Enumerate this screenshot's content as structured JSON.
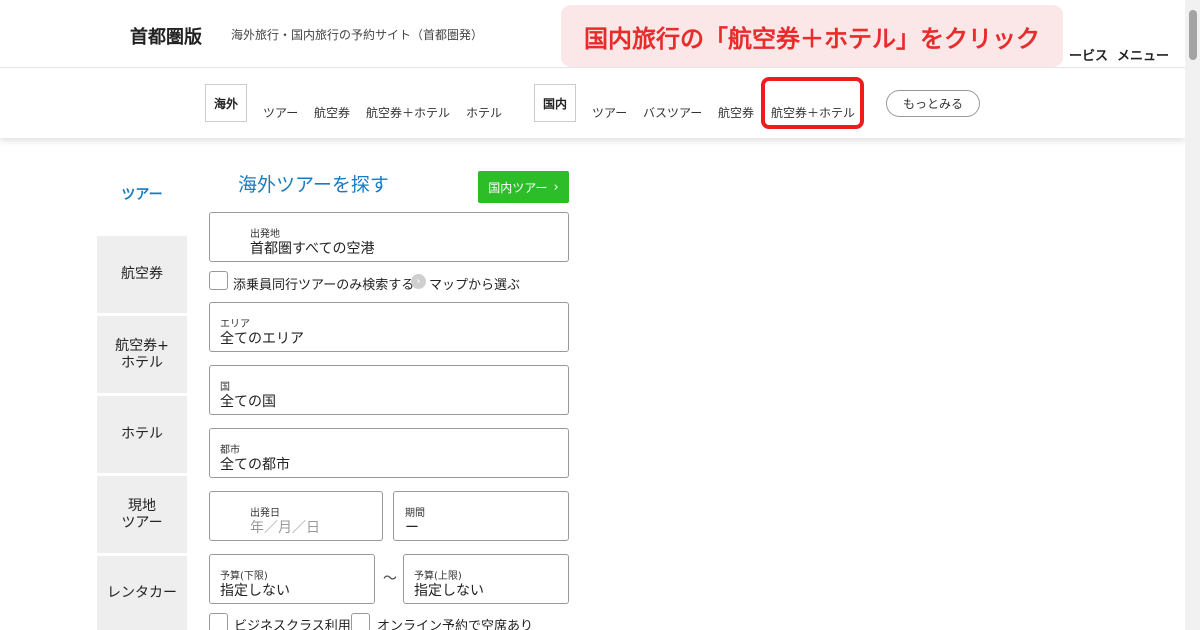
{
  "header": {
    "logo": "首都圏版",
    "tagline": "海外旅行・国内旅行の予約サイト（首都圏発）",
    "services_label": "ービス",
    "menu_label": "メニュー"
  },
  "callout": {
    "text": "国内旅行の「航空券＋ホテル」をクリック",
    "color": "#e82c2c"
  },
  "nav": {
    "overseas_badge": "海外",
    "overseas_links": [
      "ツアー",
      "航空券",
      "航空券＋ホテル",
      "ホテル"
    ],
    "domestic_badge": "国内",
    "domestic_links": [
      "ツアー",
      "バスツアー",
      "航空券",
      "航空券＋ホテル"
    ],
    "more_label": "もっとみる",
    "highlight_color": "#ee1c1c"
  },
  "sidebar": {
    "active_label": "ツアー",
    "items": [
      "航空券",
      "航空券+\nホテル",
      "ホテル",
      "現地\nツアー",
      "レンタカー"
    ]
  },
  "form": {
    "title": "海外ツアーを探す",
    "domestic_button": "国内ツアー",
    "departure": {
      "label": "出発地",
      "value": "首都圏すべての空港"
    },
    "escort_checkbox": "添乗員同行ツアーのみ検索する",
    "map_link": "マップから選ぶ",
    "area": {
      "label": "エリア",
      "value": "全てのエリア"
    },
    "country": {
      "label": "国",
      "value": "全ての国"
    },
    "city": {
      "label": "都市",
      "value": "全ての都市"
    },
    "depart_date": {
      "label": "出発日",
      "placeholder": "年／月／日"
    },
    "duration": {
      "label": "期間",
      "value": "ー"
    },
    "budget_min": {
      "label": "予算(下限)",
      "value": "指定しない"
    },
    "budget_max": {
      "label": "予算(上限)",
      "value": "指定しない"
    },
    "range_sep": "～",
    "business_class": "ビジネスクラス利用",
    "online_booking": "オンライン予約で空席あり"
  },
  "colors": {
    "accent_blue": "#1a7bc2",
    "button_green": "#2dbd29"
  }
}
